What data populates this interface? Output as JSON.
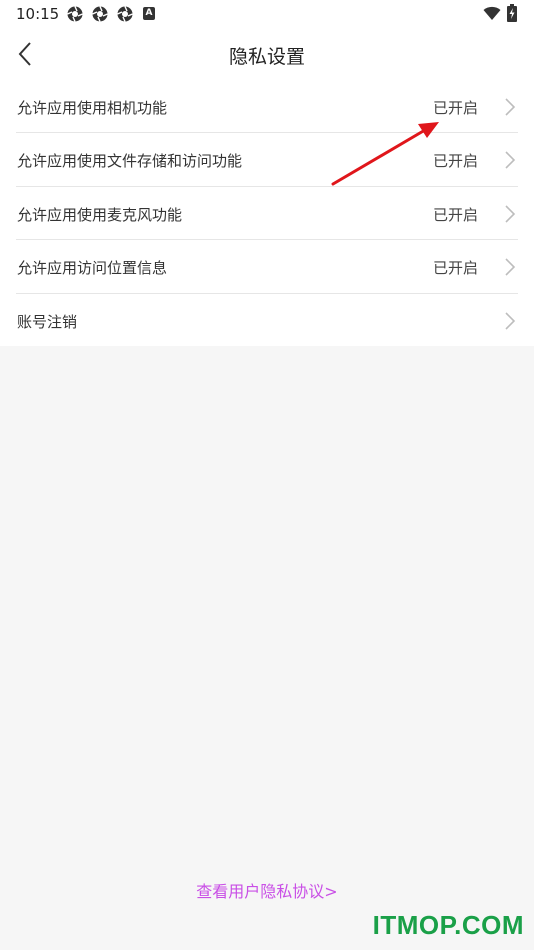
{
  "status_bar": {
    "time": "10:15",
    "notification_icons": [
      "aperture-icon",
      "aperture-icon",
      "aperture-icon",
      "app-a-icon"
    ],
    "notif_a_letter": "A"
  },
  "header": {
    "title": "隐私设置"
  },
  "settings": [
    {
      "label": "允许应用使用相机功能",
      "status": "已开启"
    },
    {
      "label": "允许应用使用文件存储和访问功能",
      "status": "已开启"
    },
    {
      "label": "允许应用使用麦克风功能",
      "status": "已开启"
    },
    {
      "label": "允许应用访问位置信息",
      "status": "已开启"
    },
    {
      "label": "账号注销",
      "status": ""
    }
  ],
  "footer": {
    "privacy_link": "查看用户隐私协议>"
  },
  "watermark": "ITMOP.COM",
  "colors": {
    "link": "#c94fe6",
    "annotation_arrow": "#e0161b",
    "watermark": "#1aa048"
  }
}
